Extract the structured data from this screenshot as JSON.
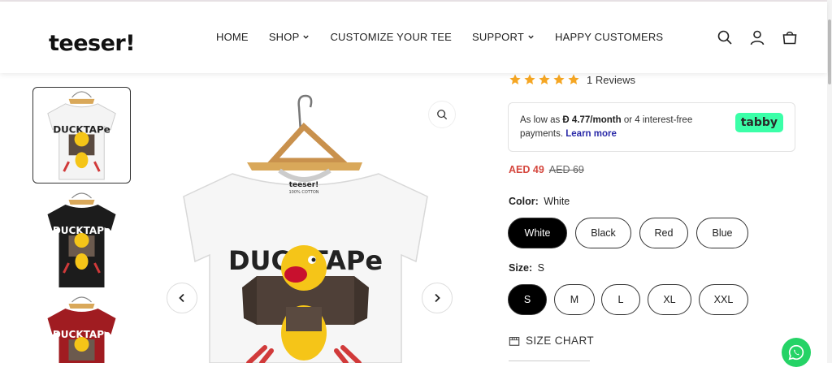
{
  "brand": {
    "logo_text": "teeser!"
  },
  "nav": {
    "items": [
      {
        "label": "HOME",
        "has_dropdown": false
      },
      {
        "label": "SHOP",
        "has_dropdown": true
      },
      {
        "label": "CUSTOMIZE YOUR TEE",
        "has_dropdown": false
      },
      {
        "label": "SUPPORT",
        "has_dropdown": true
      },
      {
        "label": "HAPPY CUSTOMERS",
        "has_dropdown": false
      }
    ]
  },
  "header_icons": [
    "search-icon",
    "account-icon",
    "cart-icon"
  ],
  "gallery": {
    "thumbnails": [
      {
        "shirt_color": "#f4f4f4",
        "selected": true
      },
      {
        "shirt_color": "#1c1c1c",
        "selected": false
      },
      {
        "shirt_color": "#a01c21",
        "selected": false
      }
    ],
    "main_shirt_color": "#f6f6f6",
    "print_text": "DUCKTAPe",
    "collar_label": "teeser!",
    "collar_sub": "100% COTTON"
  },
  "product": {
    "rating": 5,
    "reviews_label": "1 Reviews",
    "tabby": {
      "text_prefix": "As low as",
      "amount": "Đ 4.77/month",
      "text_suffix": "or 4 interest-free payments.",
      "learn_more": "Learn more",
      "logo": "tabby"
    },
    "price_now": "AED 49",
    "price_old": "AED 69",
    "color": {
      "label": "Color:",
      "selected": "White",
      "options": [
        "White",
        "Black",
        "Red",
        "Blue"
      ]
    },
    "size": {
      "label": "Size:",
      "selected": "S",
      "options": [
        "S",
        "M",
        "L",
        "XL",
        "XXL"
      ]
    },
    "size_chart_label": "SIZE CHART"
  },
  "colors": {
    "star": "#f5a623",
    "sale": "#d5473e",
    "tabby_bg": "#3bffa8",
    "whatsapp": "#25d366"
  }
}
